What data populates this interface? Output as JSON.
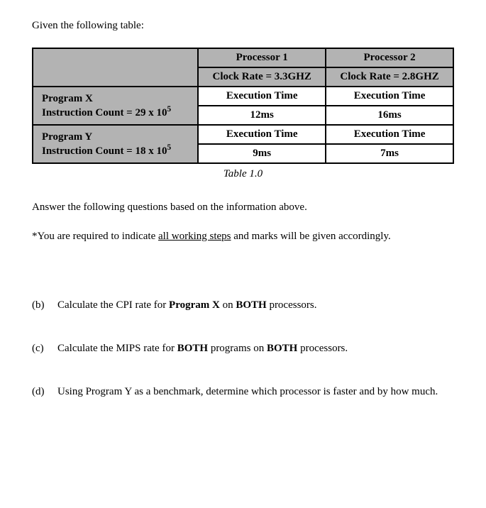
{
  "intro_text": "Given the following table:",
  "chart_data": {
    "type": "table",
    "title": "Table 1.0",
    "columns": [
      {
        "name": "Processor 1",
        "clock_rate": "Clock Rate = 3.3GHZ"
      },
      {
        "name": "Processor 2",
        "clock_rate": "Clock Rate = 2.8GHZ"
      }
    ],
    "rows": [
      {
        "program_label": "Program X",
        "instruction_count_prefix": "Instruction Count = 29 x 10",
        "instruction_count_exp": "5",
        "sub_header": "Execution Time",
        "values": [
          "12ms",
          "16ms"
        ]
      },
      {
        "program_label": "Program Y",
        "instruction_count_prefix": "Instruction Count = 18 x 10",
        "instruction_count_exp": "5",
        "sub_header": "Execution Time",
        "values": [
          "9ms",
          "7ms"
        ]
      }
    ]
  },
  "table_caption": "Table 1.0",
  "para1": "Answer the following questions based on the information above.",
  "para2_prefix": "*You are required to indicate ",
  "para2_underline": "all working steps",
  "para2_suffix": " and marks will be given accordingly.",
  "questions": {
    "b": {
      "label": "(b)",
      "text_parts": [
        "Calculate the CPI rate for ",
        "Program X",
        " on ",
        "BOTH",
        " processors."
      ]
    },
    "c": {
      "label": "(c)",
      "text_parts": [
        "Calculate the MIPS rate for ",
        "BOTH",
        " programs on ",
        "BOTH",
        " processors."
      ]
    },
    "d": {
      "label": "(d)",
      "text": "Using Program Y as a benchmark, determine which processor is faster and by how much."
    }
  }
}
